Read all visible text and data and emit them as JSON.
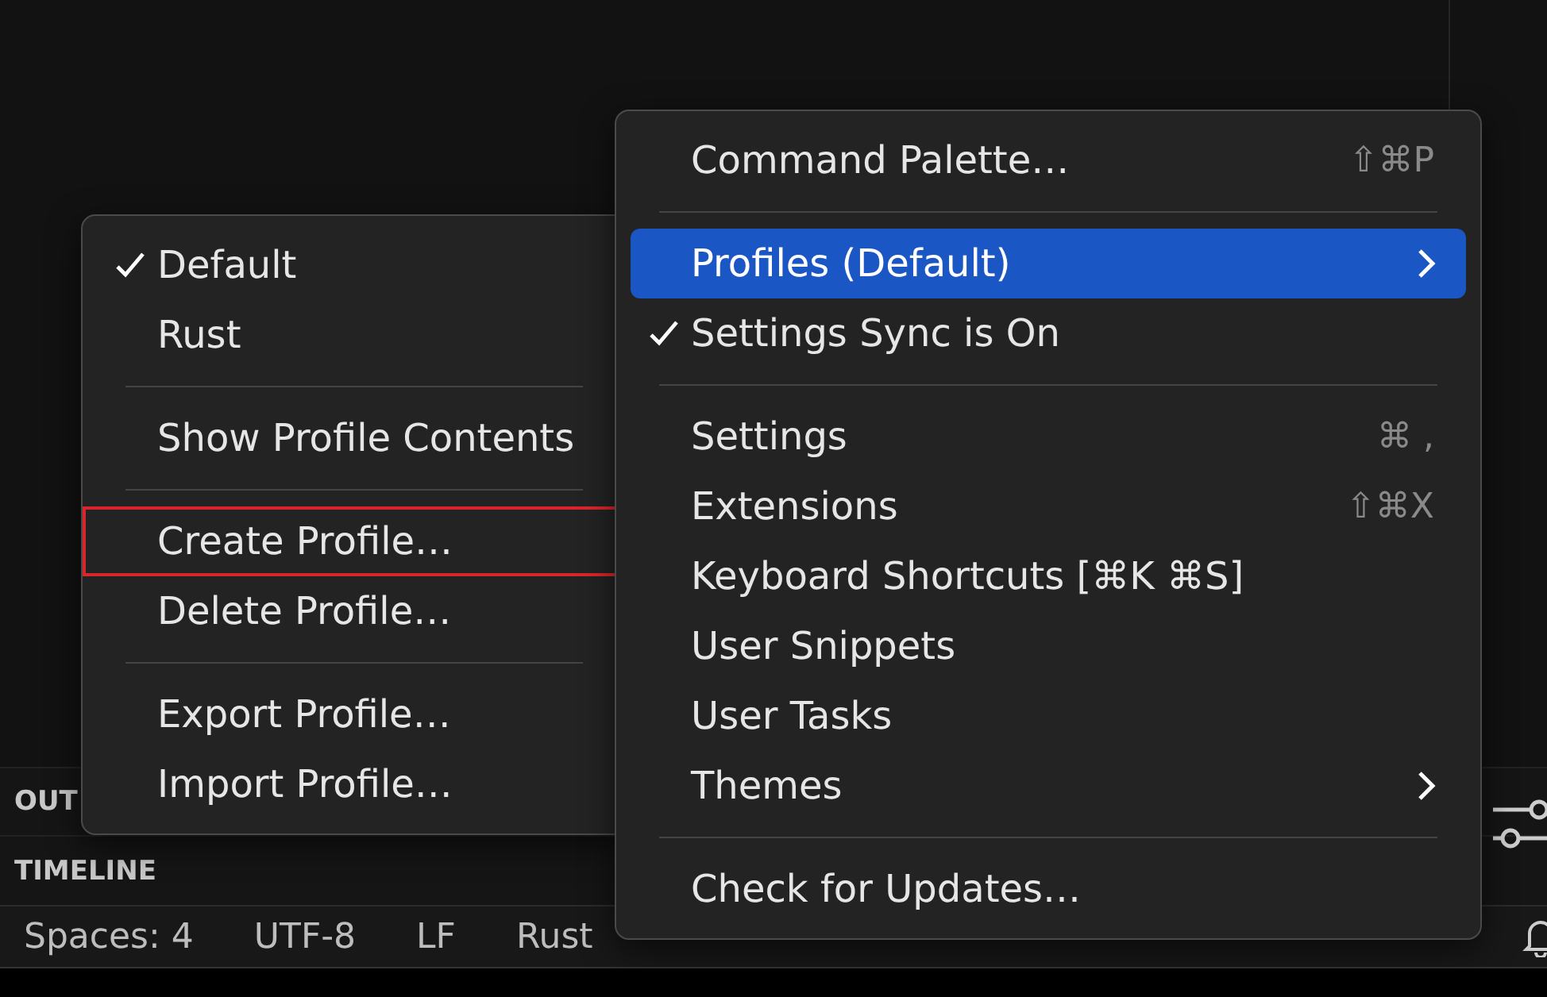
{
  "panel_headers": [
    {
      "label": "OUT"
    },
    {
      "label": "TIMELINE"
    }
  ],
  "status_bar": {
    "items": [
      "Spaces: 4",
      "UTF-8",
      "LF",
      "Rust"
    ]
  },
  "profiles_menu": {
    "items": [
      {
        "kind": "item",
        "label": "Default",
        "checked": true,
        "highlighted": false
      },
      {
        "kind": "item",
        "label": "Rust",
        "checked": false,
        "highlighted": false
      },
      {
        "kind": "separator"
      },
      {
        "kind": "item",
        "label": "Show Profile Contents",
        "checked": false,
        "highlighted": false
      },
      {
        "kind": "separator"
      },
      {
        "kind": "item",
        "label": "Create Profile…",
        "checked": false,
        "highlighted": true
      },
      {
        "kind": "item",
        "label": "Delete Profile…",
        "checked": false,
        "highlighted": false
      },
      {
        "kind": "separator"
      },
      {
        "kind": "item",
        "label": "Export Profile…",
        "checked": false,
        "highlighted": false
      },
      {
        "kind": "item",
        "label": "Import Profile…",
        "checked": false,
        "highlighted": false
      }
    ]
  },
  "main_menu": {
    "items": [
      {
        "kind": "item",
        "label": "Command Palette…",
        "shortcut": "⇧⌘P",
        "checked": false,
        "selected": false,
        "submenu": false
      },
      {
        "kind": "separator"
      },
      {
        "kind": "item",
        "label": "Profiles (Default)",
        "checked": false,
        "selected": true,
        "submenu": true
      },
      {
        "kind": "item",
        "label": "Settings Sync is On",
        "checked": true,
        "selected": false,
        "submenu": false
      },
      {
        "kind": "separator"
      },
      {
        "kind": "item",
        "label": "Settings",
        "shortcut": "⌘ ,",
        "checked": false,
        "selected": false,
        "submenu": false
      },
      {
        "kind": "item",
        "label": "Extensions",
        "shortcut": "⇧⌘X",
        "checked": false,
        "selected": false,
        "submenu": false
      },
      {
        "kind": "item",
        "label": "Keyboard Shortcuts [⌘K ⌘S]",
        "checked": false,
        "selected": false,
        "submenu": false
      },
      {
        "kind": "item",
        "label": "User Snippets",
        "checked": false,
        "selected": false,
        "submenu": false
      },
      {
        "kind": "item",
        "label": "User Tasks",
        "checked": false,
        "selected": false,
        "submenu": false
      },
      {
        "kind": "item",
        "label": "Themes",
        "checked": false,
        "selected": false,
        "submenu": true
      },
      {
        "kind": "separator"
      },
      {
        "kind": "item",
        "label": "Check for Updates…",
        "checked": false,
        "selected": false,
        "submenu": false
      }
    ]
  }
}
